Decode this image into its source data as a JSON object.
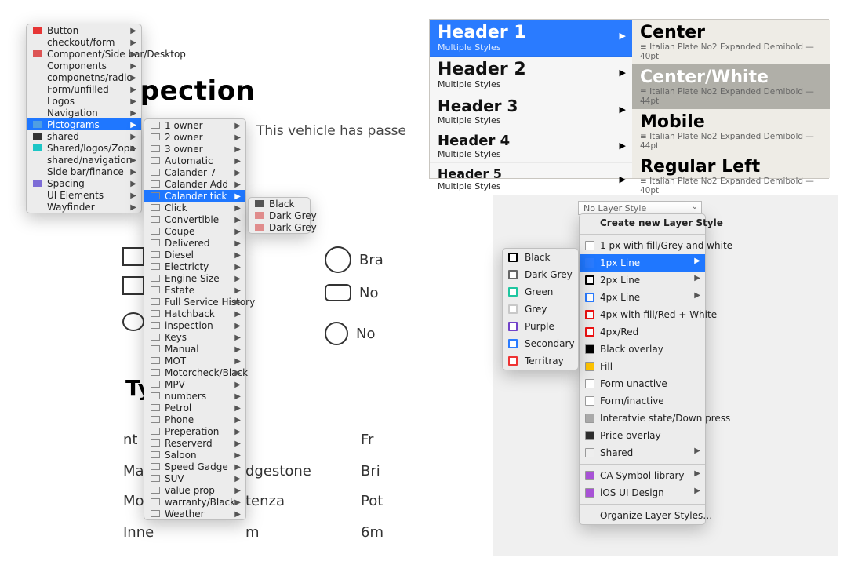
{
  "bg": {
    "title": "spection",
    "passed": "This vehicle has passe",
    "brakes": "Bra",
    "no1": "No",
    "no2": "No",
    "tyres_title": "Ty                         on",
    "front_left": "nt Left",
    "fr": "Fr",
    "mal": "Mal",
    "dge": "dgestone",
    "bri": "Bri",
    "mo": "Mo",
    "tenza": "tenza",
    "pot": "Pot",
    "inne": "Inne",
    "m": "m",
    "sixm": "6m"
  },
  "menu1": [
    {
      "label": "Button",
      "swcolor": "#e63535"
    },
    {
      "label": "checkout/form"
    },
    {
      "label": "Component/Side bar/Desktop",
      "swcolor": "#d55"
    },
    {
      "label": "Components"
    },
    {
      "label": "componetns/radio"
    },
    {
      "label": "Form/unfilled"
    },
    {
      "label": "Logos"
    },
    {
      "label": "Navigation"
    },
    {
      "label": "Pictograms",
      "swcolor": "#4f9ee3",
      "selected": true
    },
    {
      "label": "shared",
      "swcolor": "#333"
    },
    {
      "label": "Shared/logos/Zopa",
      "swcolor": "#1dc6c6"
    },
    {
      "label": "shared/navigation"
    },
    {
      "label": "Side bar/finance"
    },
    {
      "label": "Spacing",
      "swcolor": "#7d6cd6"
    },
    {
      "label": "UI Elements"
    },
    {
      "label": "Wayfinder"
    }
  ],
  "menu2": [
    "1 owner",
    "2 owner",
    "3 owner",
    "Automatic",
    "Calander 7",
    "Calander Add",
    "Calander tick",
    "Click",
    "Convertible",
    "Coupe",
    "Delivered",
    "Diesel",
    "Electricty",
    "Engine Size",
    "Estate",
    "Full Service History",
    "Hatchback",
    "inspection",
    "Keys",
    "Manual",
    "MOT",
    "Motorcheck/Black",
    "MPV",
    "numbers",
    "Petrol",
    "Phone",
    "Preperation",
    "Reserverd",
    "Saloon",
    "Speed Gadge",
    "SUV",
    "value prop",
    "warranty/Black",
    "Weather"
  ],
  "menu2_selected_index": 6,
  "menu3": [
    {
      "label": "Black",
      "swcolor": "#555"
    },
    {
      "label": "Dark Grey",
      "swcolor": "#e08c8c"
    },
    {
      "label": "Dark Grey",
      "swcolor": "#e08c8c"
    }
  ],
  "textpanel": {
    "left": [
      {
        "big": "Header 1",
        "small": "Multiple Styles",
        "selected": true
      },
      {
        "big": "Header 2",
        "small": "Multiple Styles"
      },
      {
        "big": "Header 3",
        "small": "Multiple Styles"
      },
      {
        "big": "Header 4",
        "small": "Multiple Styles"
      },
      {
        "big": "Header 5",
        "small": "Multiple Styles"
      }
    ],
    "right": [
      {
        "big": "Center",
        "det": "Italian Plate No2 Expanded Demibold — 40pt"
      },
      {
        "big": "Center/White",
        "det": "Italian Plate No2 Expanded Demibold — 44pt",
        "selected": true
      },
      {
        "big": "Mobile",
        "det": "Italian Plate No2 Expanded Demibold — 44pt"
      },
      {
        "big": "Regular Left",
        "det": "Italian Plate No2 Expanded Demibold — 40pt"
      }
    ]
  },
  "layerstyles": {
    "dropdown": "No Layer Style",
    "create": "Create new Layer Style",
    "items": [
      {
        "label": "1 px with fill/Grey and white",
        "sw": "#ffffff"
      },
      {
        "label": "1px Line",
        "sw": "#2a7bff",
        "selected": true,
        "arrow": true,
        "border": "#2a7bff"
      },
      {
        "label": "2px Line",
        "sw": "#ffffff",
        "border": "#000",
        "arrow": true
      },
      {
        "label": "4px Line",
        "sw": "#ffffff",
        "border": "#2a7bff",
        "arrow": true
      },
      {
        "label": "4px with fill/Red + White",
        "sw": "#ffffff",
        "border": "#e11"
      },
      {
        "label": "4px/Red",
        "sw": "#ffffff",
        "border": "#e11"
      },
      {
        "label": "Black overlay",
        "sw": "#000"
      },
      {
        "label": "Fill",
        "sw": "#ffc400"
      },
      {
        "label": "Form unactive",
        "sw": "#ffffff"
      },
      {
        "label": "Form/inactive",
        "sw": "#ffffff"
      },
      {
        "label": "Interatvie state/Down press",
        "sw": "#a9a9a9"
      },
      {
        "label": "Price overlay",
        "sw": "#2d2d2d"
      },
      {
        "label": "Shared",
        "sw": "#eee",
        "arrow": true
      }
    ],
    "footer1": "CA Symbol library",
    "footer2": "iOS UI Design",
    "organize": "Organize Layer Styles…"
  },
  "colmenu": [
    {
      "label": "Black",
      "sw": "#000"
    },
    {
      "label": "Dark Grey",
      "sw": "#666"
    },
    {
      "label": "Green",
      "sw": "#1fc6a0"
    },
    {
      "label": "Grey",
      "sw": "#c8c8c8"
    },
    {
      "label": "Purple",
      "sw": "#7142c9"
    },
    {
      "label": "Secondary",
      "sw": "#2a7bff"
    },
    {
      "label": "Territray",
      "sw": "#e33"
    }
  ]
}
